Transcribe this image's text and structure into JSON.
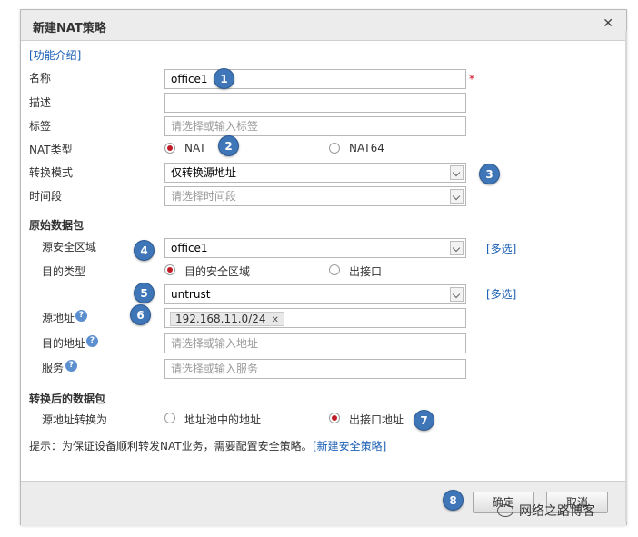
{
  "dialog": {
    "title": "新建NAT策略",
    "close_glyph": "✕",
    "help_link": "[功能介绍]"
  },
  "form": {
    "name": {
      "label": "名称",
      "value": "office1",
      "required_mark": "*"
    },
    "description": {
      "label": "描述",
      "value": ""
    },
    "tag": {
      "label": "标签",
      "placeholder": "请选择或输入标签"
    },
    "nat_type": {
      "label": "NAT类型",
      "options": [
        "NAT",
        "NAT64"
      ],
      "selected": "NAT"
    },
    "mode": {
      "label": "转换模式",
      "value": "仅转换源地址"
    },
    "time_range": {
      "label": "时间段",
      "placeholder": "请选择时间段"
    }
  },
  "original_packet": {
    "title": "原始数据包",
    "src_zone": {
      "label": "源安全区域",
      "value": "office1",
      "multi_link": "[多选]"
    },
    "dst_type": {
      "label": "目的类型",
      "options": [
        "目的安全区域",
        "出接口"
      ],
      "selected": "目的安全区域"
    },
    "dst_zone": {
      "value": "untrust",
      "multi_link": "[多选]"
    },
    "src_addr": {
      "label": "源地址",
      "tag": "192.168.11.0/24",
      "tag_remove": "✕"
    },
    "dst_addr": {
      "label": "目的地址",
      "placeholder": "请选择或输入地址"
    },
    "service": {
      "label": "服务",
      "placeholder": "请选择或输入服务"
    },
    "help_glyph": "?"
  },
  "translated_packet": {
    "title": "转换后的数据包",
    "src_translate": {
      "label": "源地址转换为",
      "options": [
        "地址池中的地址",
        "出接口地址"
      ],
      "selected": "出接口地址"
    }
  },
  "tip": {
    "text": "提示：为保证设备顺利转发NAT业务，需要配置安全策略。",
    "link": "[新建安全策略]"
  },
  "footer": {
    "ok_label": "确定",
    "cancel_label": "取消"
  },
  "badges": [
    "1",
    "2",
    "3",
    "4",
    "5",
    "6",
    "7",
    "8"
  ],
  "watermark": "网络之路博客",
  "colors": {
    "link": "#1a5fb4",
    "badge": "#3e76b8",
    "required": "#d0021b",
    "radio_selected": "#c01c28"
  }
}
